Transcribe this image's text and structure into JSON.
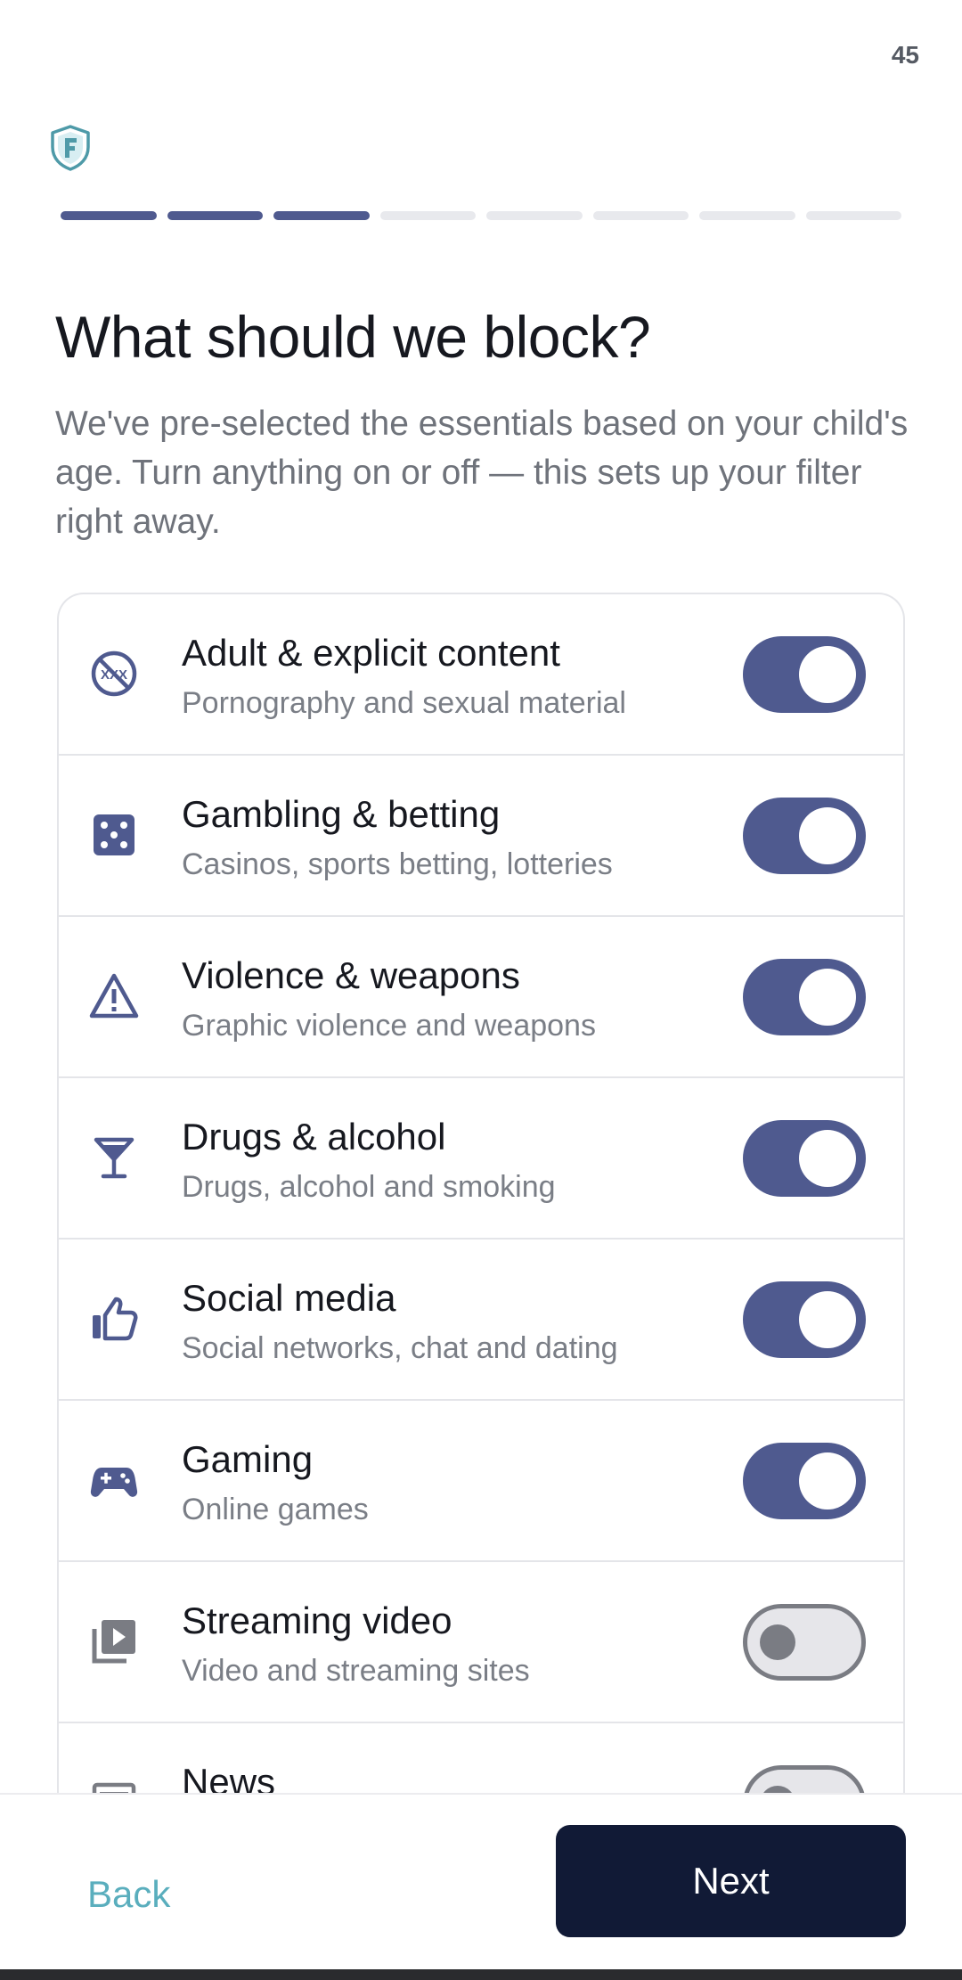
{
  "status": {
    "time": "45"
  },
  "brand": {
    "icon": "shield-f-logo",
    "color": "#4e9aa8"
  },
  "progress": {
    "total_steps": 8,
    "completed_steps": 3,
    "accent": "#4f5a8f"
  },
  "page": {
    "title": "What should we block?",
    "subtitle": "We've pre-selected the essentials based on your child's age. Turn anything on or off — this sets up your filter right away."
  },
  "categories": [
    {
      "icon": "no-xxx-icon",
      "label": "Adult & explicit content",
      "description": "Pornography and sexual material",
      "enabled": true
    },
    {
      "icon": "dice-icon",
      "label": "Gambling & betting",
      "description": "Casinos, sports betting, lotteries",
      "enabled": true
    },
    {
      "icon": "warning-icon",
      "label": "Violence & weapons",
      "description": "Graphic violence and weapons",
      "enabled": true
    },
    {
      "icon": "cocktail-icon",
      "label": "Drugs & alcohol",
      "description": "Drugs, alcohol and smoking",
      "enabled": true
    },
    {
      "icon": "thumbs-up-icon",
      "label": "Social media",
      "description": "Social networks, chat and dating",
      "enabled": true
    },
    {
      "icon": "gamepad-icon",
      "label": "Gaming",
      "description": "Online games",
      "enabled": true
    },
    {
      "icon": "video-library-icon",
      "label": "Streaming video",
      "description": "Video and streaming sites",
      "enabled": false
    },
    {
      "icon": "newspaper-icon",
      "label": "News",
      "description": "",
      "enabled": false
    }
  ],
  "footer": {
    "back_label": "Back",
    "next_label": "Next"
  },
  "colors": {
    "toggle_on": "#4f5a8f",
    "toggle_off": "#e6e6ea",
    "next_button": "#111a36",
    "back_text": "#5aaebd"
  }
}
